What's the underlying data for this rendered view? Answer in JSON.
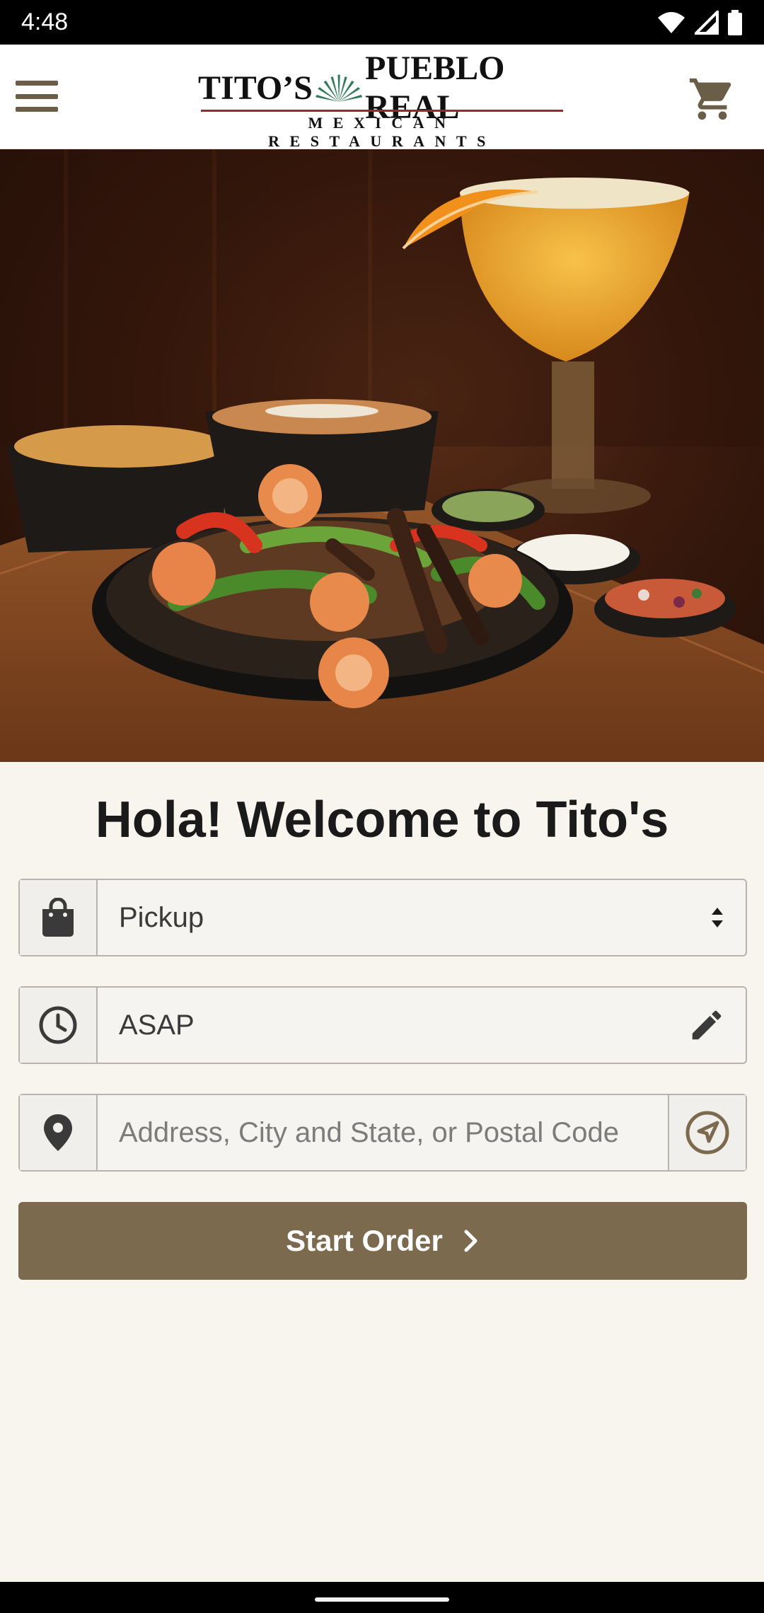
{
  "status_bar": {
    "time": "4:48",
    "icons": [
      "wifi-icon",
      "signal-icon",
      "battery-icon"
    ]
  },
  "header": {
    "logo_main": "TITO’S PUEBLO REAL",
    "logo_part1": "TITO’S",
    "logo_part2": "PUEBLO REAL",
    "logo_sub": "MEXICAN RESTAURANTS",
    "menu_icon": "hamburger-menu-icon",
    "cart_icon": "shopping-cart-icon"
  },
  "hero": {
    "content": "fajita-platter-with-margarita-photo"
  },
  "welcome": {
    "title": "Hola! Welcome to Tito's"
  },
  "form": {
    "order_type": {
      "value": "Pickup",
      "icon": "shopping-bag-icon",
      "trail_icon": "sort-arrows-icon"
    },
    "time": {
      "value": "ASAP",
      "icon": "clock-icon",
      "trail_icon": "pencil-edit-icon"
    },
    "address": {
      "value": "",
      "placeholder": "Address, City and State, or Postal Code",
      "icon": "map-pin-icon",
      "locate_icon": "navigation-arrow-icon"
    },
    "start_label": "Start Order"
  },
  "colors": {
    "brand_brown": "#7b6a4e",
    "header_icon": "#6b5e48",
    "background": "#f8f5ee",
    "logo_red": "#a3222b",
    "agave_green": "#2f7a5a"
  }
}
